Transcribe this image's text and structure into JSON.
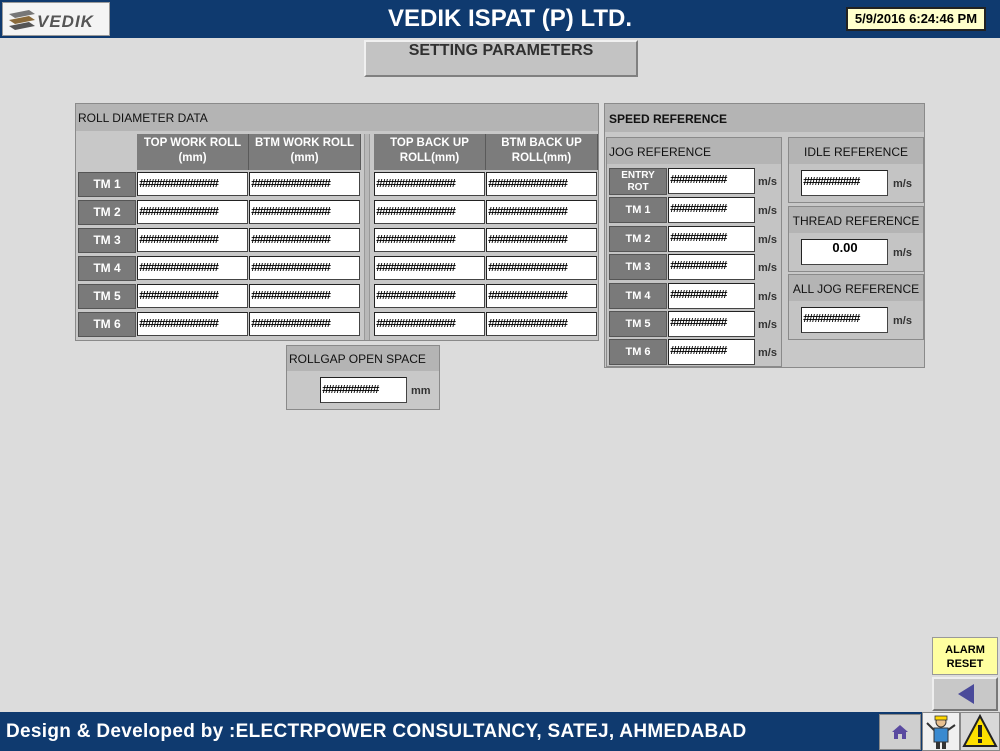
{
  "header": {
    "logo_text": "VEDIK",
    "title": "VEDIK ISPAT (P) LTD.",
    "datetime": "5/9/2016 6:24:46 PM"
  },
  "page_title": "SETTING PARAMETERS",
  "roll_diameter": {
    "title": "ROLL DIAMETER DATA",
    "columns": [
      {
        "line1": "TOP WORK ROLL",
        "line2": "(mm)"
      },
      {
        "line1": "BTM WORK ROLL",
        "line2": "(mm)"
      },
      {
        "line1": "TOP BACK UP",
        "line2": "ROLL(mm)"
      },
      {
        "line1": "BTM BACK UP",
        "line2": "ROLL(mm)"
      }
    ],
    "rows": [
      {
        "label": "TM 1",
        "values": [
          "##############",
          "##############",
          "##############",
          "##############"
        ]
      },
      {
        "label": "TM 2",
        "values": [
          "##############",
          "##############",
          "##############",
          "##############"
        ]
      },
      {
        "label": "TM 3",
        "values": [
          "##############",
          "##############",
          "##############",
          "##############"
        ]
      },
      {
        "label": "TM 4",
        "values": [
          "##############",
          "##############",
          "##############",
          "##############"
        ]
      },
      {
        "label": "TM 5",
        "values": [
          "##############",
          "##############",
          "##############",
          "##############"
        ]
      },
      {
        "label": "TM 6",
        "values": [
          "##############",
          "##############",
          "##############",
          "##############"
        ]
      }
    ]
  },
  "rollgap": {
    "title": "ROLLGAP OPEN SPACE",
    "value": "##########",
    "unit": "mm"
  },
  "speed_reference": {
    "title": "SPEED REFERENCE",
    "jog": {
      "title": "JOG REFERENCE",
      "rows": [
        {
          "label_line1": "ENTRY",
          "label_line2": "ROT",
          "value": "##########",
          "unit": "m/s"
        },
        {
          "label_line1": "TM 1",
          "label_line2": "",
          "value": "##########",
          "unit": "m/s"
        },
        {
          "label_line1": "TM 2",
          "label_line2": "",
          "value": "##########",
          "unit": "m/s"
        },
        {
          "label_line1": "TM 3",
          "label_line2": "",
          "value": "##########",
          "unit": "m/s"
        },
        {
          "label_line1": "TM 4",
          "label_line2": "",
          "value": "##########",
          "unit": "m/s"
        },
        {
          "label_line1": "TM 5",
          "label_line2": "",
          "value": "##########",
          "unit": "m/s"
        },
        {
          "label_line1": "TM 6",
          "label_line2": "",
          "value": "##########",
          "unit": "m/s"
        }
      ]
    },
    "idle": {
      "title": "IDLE REFERENCE",
      "value": "##########",
      "unit": "m/s"
    },
    "thread": {
      "title": "THREAD REFERENCE",
      "value": "0.00",
      "unit": "m/s"
    },
    "all_jog": {
      "title": "ALL JOG REFERENCE",
      "value": "##########",
      "unit": "m/s"
    }
  },
  "alarm_reset": {
    "line1": "ALARM",
    "line2": "RESET"
  },
  "footer": {
    "text": "Design & Developed by :ELECTRPOWER CONSULTANCY, SATEJ, AHMEDABAD"
  },
  "colors": {
    "header_bg": "#0f3a6f",
    "panel_bg": "#c8c8c8",
    "label_bg": "#7a7a7a",
    "datetime_bg": "#ffffcc",
    "alarm_bg": "#ffffa0",
    "warning_yellow": "#ffe000"
  },
  "icons": [
    "vedik-logo",
    "home-icon",
    "operator-icon",
    "warning-icon",
    "back-arrow-icon"
  ]
}
